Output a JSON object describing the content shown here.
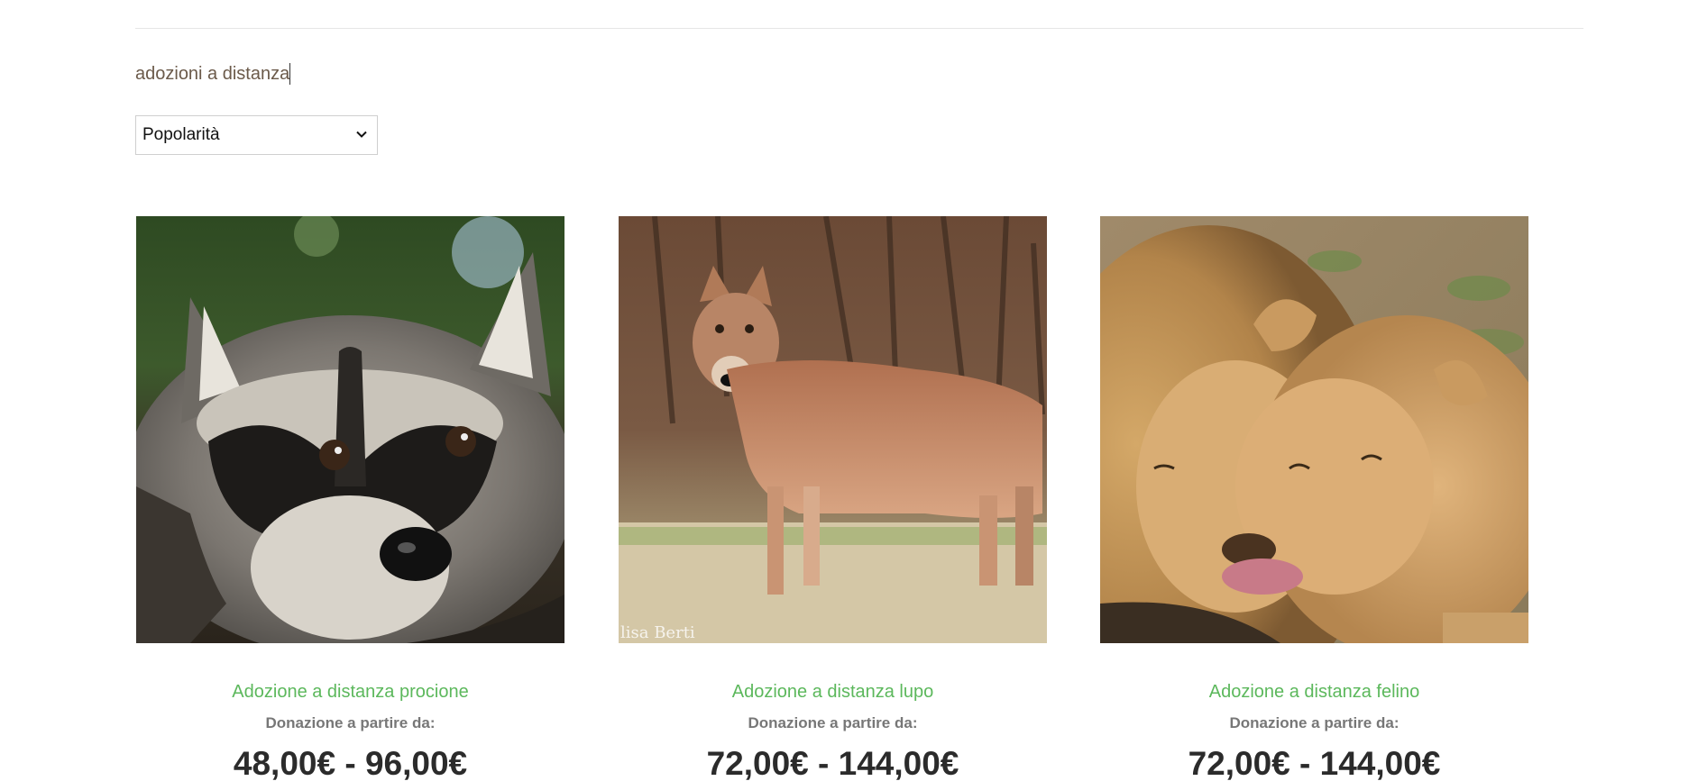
{
  "search": {
    "query": "adozioni a distanza"
  },
  "sort": {
    "selected": "Popolarità"
  },
  "products": [
    {
      "title": "Adozione a distanza procione",
      "label": "Donazione a partire da:",
      "price": "48,00€ - 96,00€",
      "image": "raccoon-photo"
    },
    {
      "title": "Adozione a distanza lupo",
      "label": "Donazione a partire da:",
      "price": "72,00€ - 144,00€",
      "image": "wolf-photo",
      "watermark": "lisa Berti"
    },
    {
      "title": "Adozione a distanza felino",
      "label": "Donazione a partire da:",
      "price": "72,00€ - 144,00€",
      "image": "lions-photo"
    }
  ]
}
